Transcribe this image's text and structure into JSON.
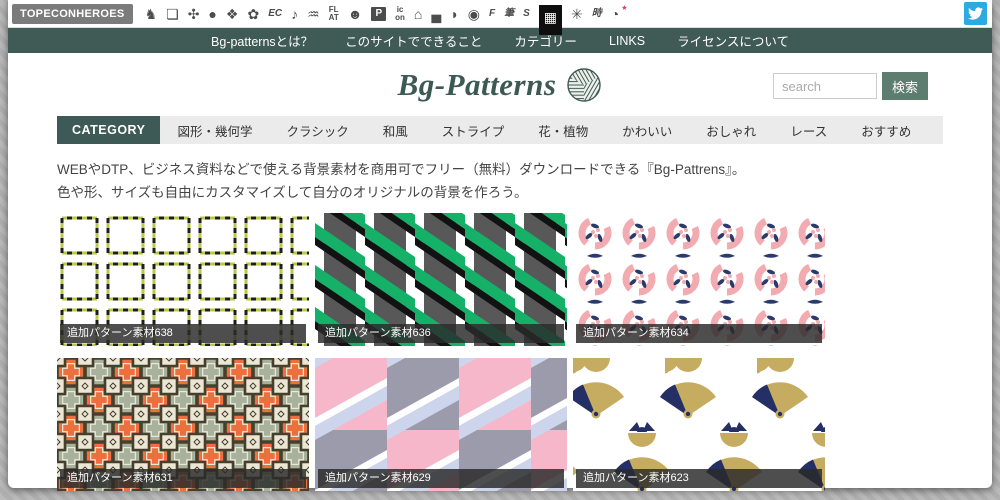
{
  "toolbar": {
    "brand": "TOPECONHEROES",
    "icons": [
      {
        "name": "boar-icon",
        "glyph": "♞",
        "cls": ""
      },
      {
        "name": "copy-icon",
        "glyph": "❏",
        "cls": ""
      },
      {
        "name": "person-icon",
        "glyph": "✣",
        "cls": ""
      },
      {
        "name": "speech-bubble-icon",
        "glyph": "●",
        "cls": ""
      },
      {
        "name": "stamp-icon",
        "glyph": "❖",
        "cls": ""
      },
      {
        "name": "flower-icon",
        "glyph": "✿",
        "cls": ""
      },
      {
        "name": "ec-icon",
        "glyph": "EC",
        "cls": "text"
      },
      {
        "name": "music-note-icon",
        "glyph": "♪",
        "cls": ""
      },
      {
        "name": "line-wave-icon",
        "glyph": "♒",
        "cls": ""
      },
      {
        "name": "flat-icon",
        "glyph": "FL\nAT",
        "cls": "two"
      },
      {
        "name": "smiley-icon",
        "glyph": "☻",
        "cls": ""
      },
      {
        "name": "p-square-icon",
        "glyph": "P",
        "cls": "box"
      },
      {
        "name": "icon-text-icon",
        "glyph": "ic\non",
        "cls": "two"
      },
      {
        "name": "building-icon",
        "glyph": "⌂",
        "cls": ""
      },
      {
        "name": "sofa-icon",
        "glyph": "▄",
        "cls": ""
      },
      {
        "name": "bird-icon",
        "glyph": "◗",
        "cls": ""
      },
      {
        "name": "sphere-icon",
        "glyph": "◉",
        "cls": ""
      },
      {
        "name": "f-letter-icon",
        "glyph": "F",
        "cls": "text"
      },
      {
        "name": "brush-kanji-icon",
        "glyph": "筆",
        "cls": "text"
      },
      {
        "name": "s-letter-icon",
        "glyph": "S",
        "cls": "text"
      },
      {
        "name": "bg-patterns-grid-icon",
        "glyph": "▦",
        "cls": "active"
      },
      {
        "name": "rays-icon",
        "glyph": "✳",
        "cls": ""
      },
      {
        "name": "toki-kanji-icon",
        "glyph": "時",
        "cls": "text"
      },
      {
        "name": "clock-icon",
        "glyph": "◔",
        "cls": ""
      },
      {
        "name": "star-badge-icon",
        "glyph": "★",
        "cls": "badge"
      }
    ]
  },
  "navbar": {
    "items": [
      "Bg-patternsとは？",
      "このサイトでできること",
      "カテゴリー",
      "LINKS",
      "ライセンスについて"
    ]
  },
  "header": {
    "logo": "Bg-Patterns",
    "search_placeholder": "search",
    "search_button": "検索"
  },
  "tabs": [
    {
      "label": "CATEGORY",
      "active": true
    },
    {
      "label": "図形・幾何学",
      "active": false
    },
    {
      "label": "クラシック",
      "active": false
    },
    {
      "label": "和風",
      "active": false
    },
    {
      "label": "ストライプ",
      "active": false
    },
    {
      "label": "花・植物",
      "active": false
    },
    {
      "label": "かわいい",
      "active": false
    },
    {
      "label": "おしゃれ",
      "active": false
    },
    {
      "label": "レース",
      "active": false
    },
    {
      "label": "おすすめ",
      "active": false
    }
  ],
  "intro": [
    "WEBやDTP、ビジネス資料などで使える背景素材を商用可でフリー（無料）ダウンロードできる『Bg-Pattrens』。",
    "色や形、サイズも自由にカスタマイズして自分のオリジナルの背景を作ろう。"
  ],
  "cards": [
    {
      "caption": "追加パターン素材638",
      "pattern": "p638",
      "colors": [
        "#ffffff",
        "#b9c848",
        "#1e1e1e"
      ]
    },
    {
      "caption": "追加パターン素材636",
      "pattern": "p636",
      "colors": [
        "#ffffff",
        "#16b169",
        "#585858",
        "#121212"
      ]
    },
    {
      "caption": "追加パターン素材634",
      "pattern": "p634",
      "colors": [
        "#ffffff",
        "#f2abb0",
        "#2a3a6d"
      ]
    },
    {
      "caption": "追加パターン素材631",
      "pattern": "p631",
      "colors": [
        "#ebe7d4",
        "#ec6f3e",
        "#a8b19c",
        "#45402e"
      ]
    },
    {
      "caption": "追加パターン素材629",
      "pattern": "p629",
      "colors": [
        "#f6b7cb",
        "#9b9bac",
        "#ccd5ec",
        "#ffffff"
      ]
    },
    {
      "caption": "追加パターン素材623",
      "pattern": "p623",
      "colors": [
        "#ffffff",
        "#c6ac61",
        "#242f66"
      ]
    }
  ],
  "colors": {
    "accent_teal": "#3e5a56",
    "search_button": "#5d7d70",
    "twitter_blue": "#2caae1",
    "caption_bar": "#2a2a2a",
    "page_background": "#b5b5b5"
  }
}
